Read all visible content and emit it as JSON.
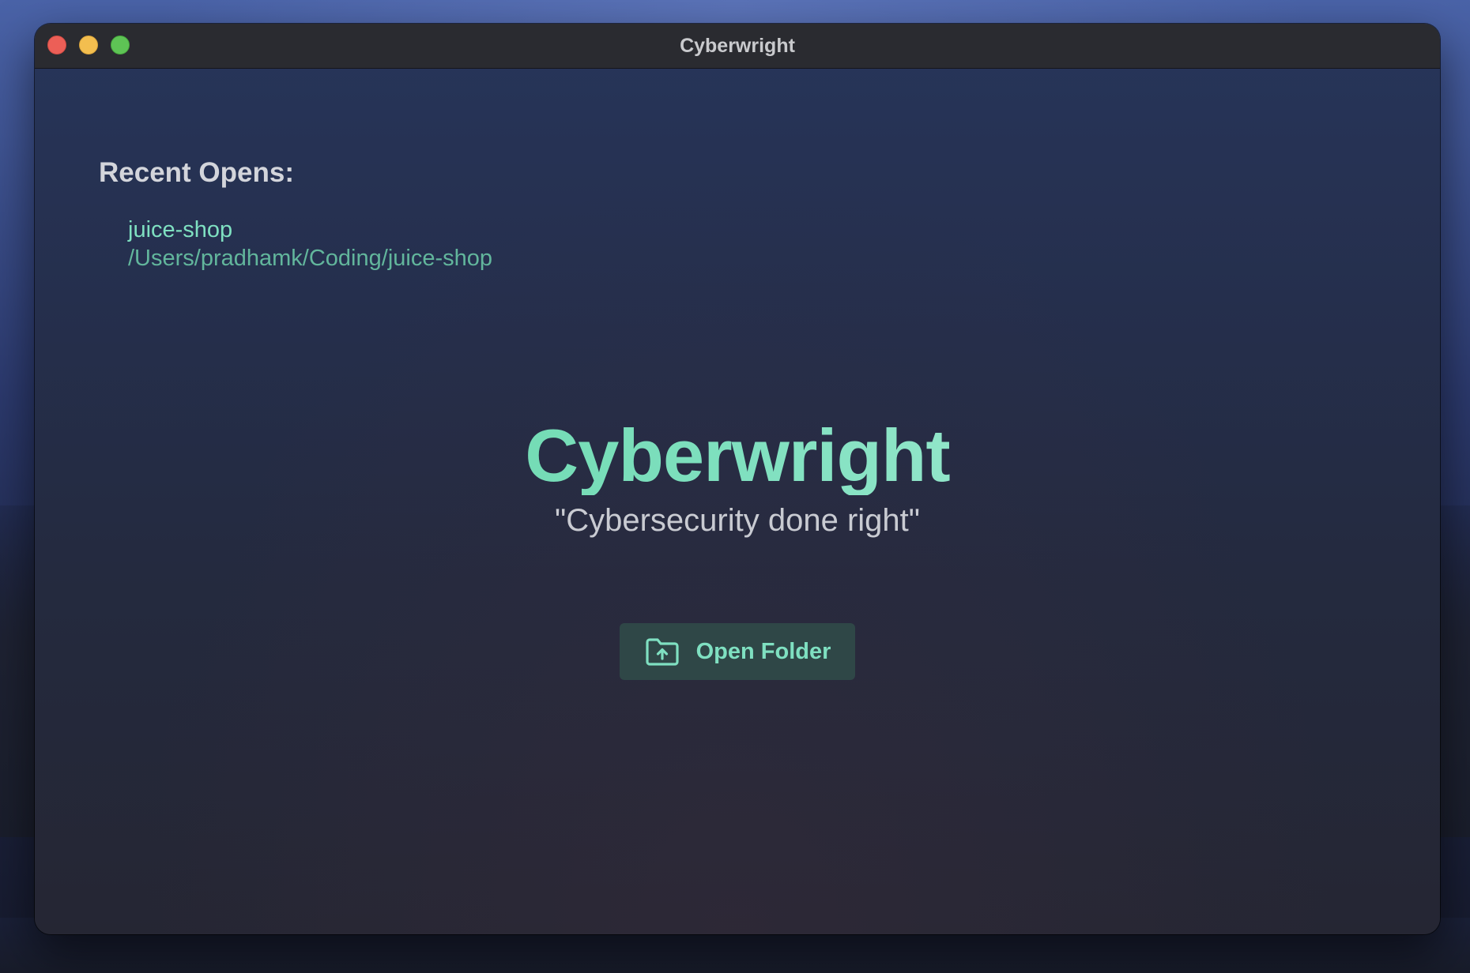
{
  "window": {
    "title": "Cyberwright"
  },
  "recent": {
    "heading": "Recent Opens:",
    "items": [
      {
        "name": "juice-shop",
        "path": "/Users/pradhamk/Coding/juice-shop"
      }
    ]
  },
  "hero": {
    "title": "Cyberwright",
    "tagline": "\"Cybersecurity done right\""
  },
  "actions": {
    "open_folder_label": "Open Folder",
    "open_folder_icon": "folder-upload-icon"
  },
  "colors": {
    "accent": "#7fe0c1",
    "button_bg": "#2f4747",
    "traffic_close": "#ec5f57",
    "traffic_minimize": "#f3be4f",
    "traffic_maximize": "#5ec455"
  }
}
